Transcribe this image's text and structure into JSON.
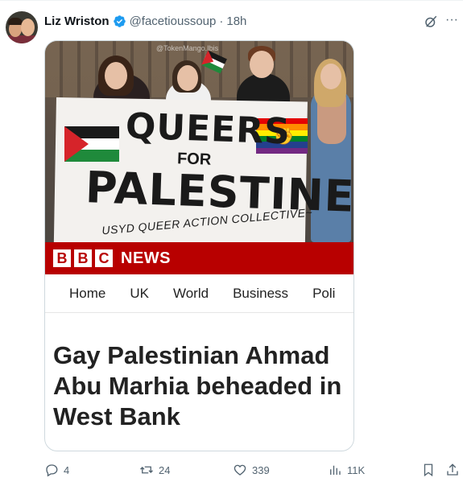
{
  "tweet": {
    "author_name": "Liz Wriston",
    "handle": "@facetioussoup",
    "separator": "·",
    "time": "18h",
    "more_label": "···"
  },
  "image": {
    "watermark": "@TokenMango.Ibis",
    "banner": {
      "line1": "QUEERS",
      "line2": "FOR",
      "line3": "PALESTINE",
      "line4": "USYD QUEER ACTION COLLECTIVE~"
    },
    "bbc": {
      "logo_letters": [
        "B",
        "B",
        "C"
      ],
      "news": "NEWS",
      "nav": [
        "Home",
        "UK",
        "World",
        "Business",
        "Poli"
      ],
      "headline": "Gay Palestinian Ahmad Abu Marhia beheaded in West Bank"
    }
  },
  "actions": {
    "replies": "4",
    "reposts": "24",
    "likes": "339",
    "views": "11K"
  },
  "colors": {
    "bbc_red": "#b80000",
    "verified_blue": "#1d9bf0",
    "muted_text": "#536471"
  }
}
